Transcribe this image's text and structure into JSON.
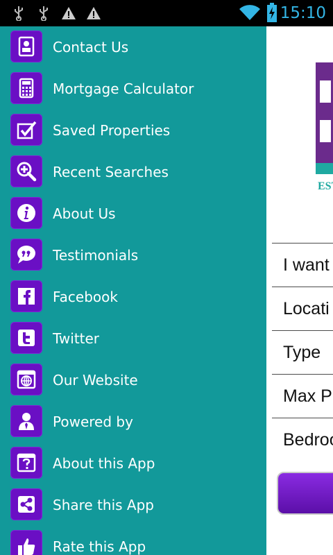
{
  "status_bar": {
    "time": "15:10",
    "icons": [
      "usb-icon",
      "usb-icon",
      "warning-icon",
      "warning-icon",
      "wifi-icon",
      "battery-charging-icon"
    ]
  },
  "drawer": {
    "background": "#12999a",
    "tile_color": "#6a0fc4",
    "items": [
      {
        "label": "Contact Us",
        "icon": "contact-card-icon"
      },
      {
        "label": "Mortgage Calculator",
        "icon": "calculator-icon"
      },
      {
        "label": "Saved Properties",
        "icon": "checkbox-icon"
      },
      {
        "label": "Recent Searches",
        "icon": "magnifier-plus-icon"
      },
      {
        "label": "About Us",
        "icon": "info-icon"
      },
      {
        "label": "Testimonials",
        "icon": "quote-bubble-icon"
      },
      {
        "label": "Facebook",
        "icon": "facebook-icon"
      },
      {
        "label": "Twitter",
        "icon": "twitter-icon"
      },
      {
        "label": "Our Website",
        "icon": "globe-window-icon"
      },
      {
        "label": "Powered by",
        "icon": "person-icon"
      },
      {
        "label": "About this App",
        "icon": "question-window-icon"
      },
      {
        "label": "Share this App",
        "icon": "share-icon"
      },
      {
        "label": "Rate this App",
        "icon": "thumbs-up-icon"
      }
    ]
  },
  "main": {
    "logo_text": "EST",
    "form_rows": [
      "I want",
      "Locati",
      "Type",
      "Max Pr",
      "Bedroo"
    ]
  }
}
